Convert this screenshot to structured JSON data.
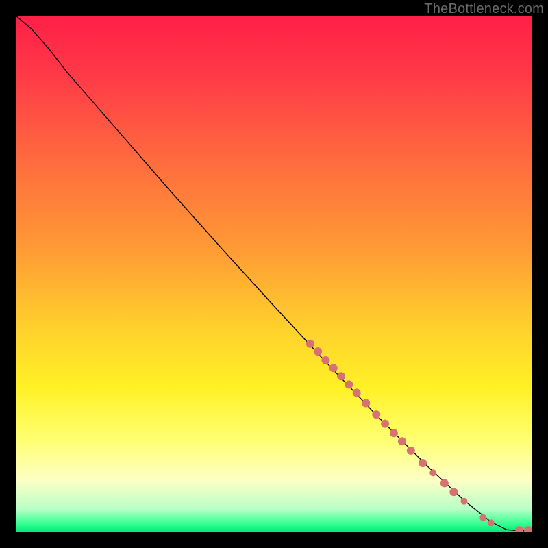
{
  "watermark": "TheBottleneck.com",
  "chart_data": {
    "type": "line",
    "title": "",
    "xlabel": "",
    "ylabel": "",
    "xlim": [
      0,
      1
    ],
    "ylim": [
      0,
      1
    ],
    "background": {
      "kind": "vertical-gradient",
      "stops": [
        {
          "pos": 0.0,
          "color": "#ff1f47"
        },
        {
          "pos": 0.12,
          "color": "#ff3b47"
        },
        {
          "pos": 0.28,
          "color": "#ff6b3e"
        },
        {
          "pos": 0.45,
          "color": "#ff9a35"
        },
        {
          "pos": 0.6,
          "color": "#ffcf2c"
        },
        {
          "pos": 0.72,
          "color": "#fff126"
        },
        {
          "pos": 0.82,
          "color": "#ffff70"
        },
        {
          "pos": 0.9,
          "color": "#fdffc5"
        },
        {
          "pos": 0.955,
          "color": "#b8ffc6"
        },
        {
          "pos": 0.985,
          "color": "#2fff8e"
        },
        {
          "pos": 1.0,
          "color": "#00e57a"
        }
      ]
    },
    "curve": [
      {
        "x": 0.0,
        "y": 1.0
      },
      {
        "x": 0.03,
        "y": 0.975
      },
      {
        "x": 0.065,
        "y": 0.935
      },
      {
        "x": 0.1,
        "y": 0.89
      },
      {
        "x": 0.2,
        "y": 0.775
      },
      {
        "x": 0.3,
        "y": 0.66
      },
      {
        "x": 0.4,
        "y": 0.548
      },
      {
        "x": 0.5,
        "y": 0.438
      },
      {
        "x": 0.6,
        "y": 0.33
      },
      {
        "x": 0.7,
        "y": 0.225
      },
      {
        "x": 0.8,
        "y": 0.125
      },
      {
        "x": 0.87,
        "y": 0.06
      },
      {
        "x": 0.92,
        "y": 0.02
      },
      {
        "x": 0.95,
        "y": 0.005
      },
      {
        "x": 0.975,
        "y": 0.003
      },
      {
        "x": 1.0,
        "y": 0.003
      }
    ],
    "points": [
      {
        "x": 0.57,
        "y": 0.365,
        "r": 6
      },
      {
        "x": 0.585,
        "y": 0.35,
        "r": 6
      },
      {
        "x": 0.6,
        "y": 0.333,
        "r": 6
      },
      {
        "x": 0.615,
        "y": 0.318,
        "r": 6
      },
      {
        "x": 0.63,
        "y": 0.302,
        "r": 6
      },
      {
        "x": 0.645,
        "y": 0.286,
        "r": 6
      },
      {
        "x": 0.66,
        "y": 0.27,
        "r": 6
      },
      {
        "x": 0.678,
        "y": 0.25,
        "r": 6
      },
      {
        "x": 0.698,
        "y": 0.228,
        "r": 6
      },
      {
        "x": 0.715,
        "y": 0.21,
        "r": 6
      },
      {
        "x": 0.732,
        "y": 0.192,
        "r": 6
      },
      {
        "x": 0.748,
        "y": 0.176,
        "r": 6
      },
      {
        "x": 0.765,
        "y": 0.158,
        "r": 6
      },
      {
        "x": 0.788,
        "y": 0.134,
        "r": 6
      },
      {
        "x": 0.808,
        "y": 0.115,
        "r": 5
      },
      {
        "x": 0.83,
        "y": 0.095,
        "r": 6
      },
      {
        "x": 0.848,
        "y": 0.078,
        "r": 6
      },
      {
        "x": 0.868,
        "y": 0.06,
        "r": 5
      },
      {
        "x": 0.905,
        "y": 0.028,
        "r": 5
      },
      {
        "x": 0.92,
        "y": 0.018,
        "r": 5
      },
      {
        "x": 0.975,
        "y": 0.004,
        "r": 6
      },
      {
        "x": 0.992,
        "y": 0.004,
        "r": 6
      }
    ],
    "point_color": "#d87171",
    "line_color": "#000000",
    "line_width": 1.4
  }
}
